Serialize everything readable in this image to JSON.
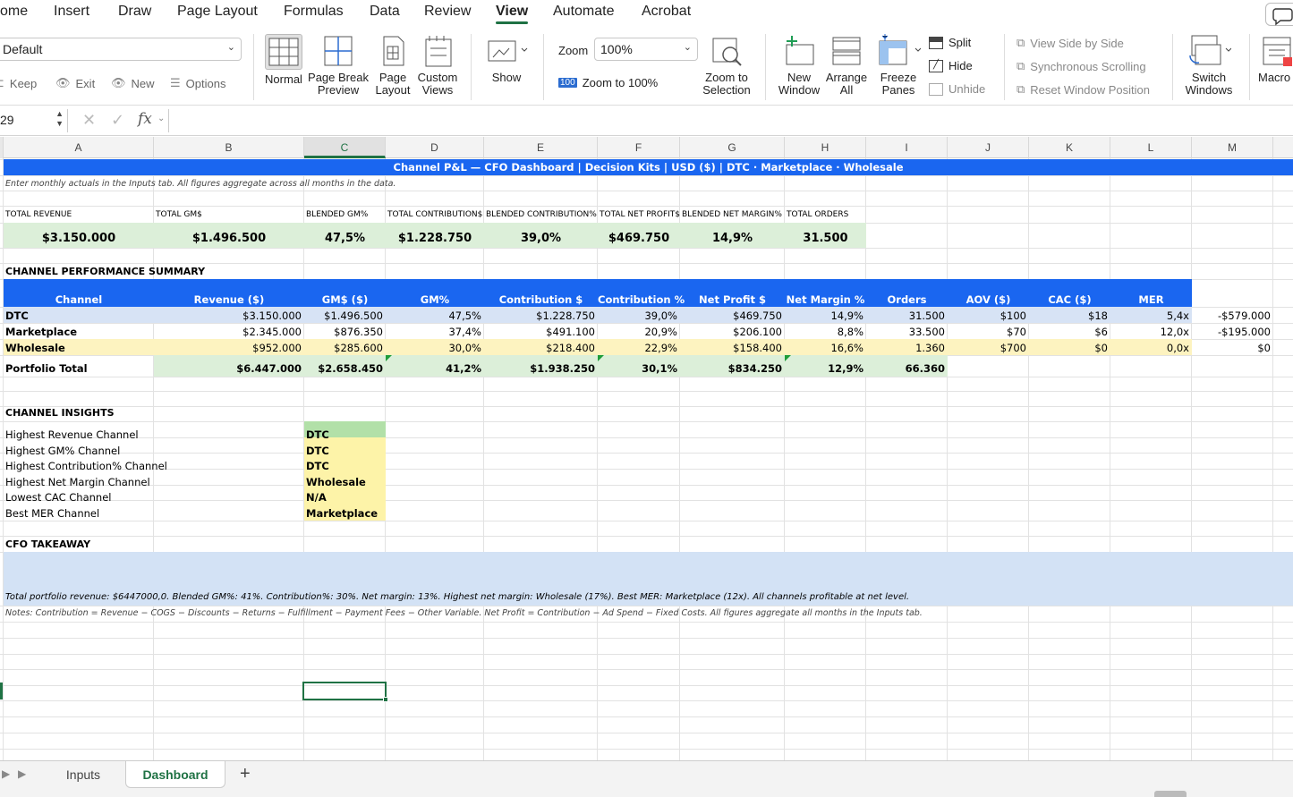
{
  "menu": {
    "tabs": [
      "ome",
      "Insert",
      "Draw",
      "Page Layout",
      "Formulas",
      "Data",
      "Review",
      "View",
      "Automate",
      "Acrobat"
    ],
    "active": "View"
  },
  "ribbon": {
    "sheet_view_combo": "Default",
    "keep": "Keep",
    "exit": "Exit",
    "new": "New",
    "options": "Options",
    "normal": "Normal",
    "page_break_preview": [
      "Page Break",
      "Preview"
    ],
    "page_layout": [
      "Page",
      "Layout"
    ],
    "custom_views": [
      "Custom",
      "Views"
    ],
    "show": "Show",
    "zoom_label": "Zoom",
    "zoom_value": "100%",
    "zoom_100_icon_text": "100",
    "zoom_to_100": "Zoom to 100%",
    "zoom_to_selection": [
      "Zoom to",
      "Selection"
    ],
    "new_window": [
      "New",
      "Window"
    ],
    "arrange_all": [
      "Arrange",
      "All"
    ],
    "freeze_panes": [
      "Freeze",
      "Panes"
    ],
    "split": "Split",
    "hide": "Hide",
    "unhide": "Unhide",
    "view_side_by_side": "View Side by Side",
    "synchronous_scrolling": "Synchronous Scrolling",
    "reset_window_position": "Reset Window Position",
    "switch_windows": [
      "Switch",
      "Windows"
    ],
    "macros": "Macro"
  },
  "formula_bar": {
    "name_box": "29",
    "fx": "fx",
    "formula": ""
  },
  "columns": [
    "A",
    "B",
    "C",
    "D",
    "E",
    "F",
    "G",
    "H",
    "I",
    "J",
    "K",
    "L",
    "M"
  ],
  "selected_column": "C",
  "sheet": {
    "title": "Channel P&L — CFO Dashboard  |  Decision Kits  |  USD ($)  |  DTC · Marketplace · Wholesale",
    "subtitle": "Enter monthly actuals in the Inputs tab. All figures aggregate across all months in the data.",
    "kpi_labels": [
      "TOTAL REVENUE",
      "TOTAL GM$",
      "BLENDED GM%",
      "TOTAL CONTRIBUTION$",
      "BLENDED CONTRIBUTION%",
      "TOTAL NET PROFIT$",
      "BLENDED NET MARGIN%",
      "TOTAL ORDERS"
    ],
    "kpi_values": [
      "$3.150.000",
      "$1.496.500",
      "47,5%",
      "$1.228.750",
      "39,0%",
      "$469.750",
      "14,9%",
      "31.500"
    ],
    "perf_header": "CHANNEL PERFORMANCE SUMMARY",
    "table_headers": [
      "Channel",
      "Revenue ($)",
      "GM$ ($)",
      "GM%",
      "Contribution $",
      "Contribution %",
      "Net Profit $",
      "Net Margin %",
      "Orders",
      "AOV ($)",
      "CAC ($)",
      "MER"
    ],
    "rows": [
      {
        "channel": "DTC",
        "values": [
          "$3.150.000",
          "$1.496.500",
          "47,5%",
          "$1.228.750",
          "39,0%",
          "$469.750",
          "14,9%",
          "31.500",
          "$100",
          "$18",
          "5,4x",
          "-$579.000"
        ]
      },
      {
        "channel": "Marketplace",
        "values": [
          "$2.345.000",
          "$876.350",
          "37,4%",
          "$491.100",
          "20,9%",
          "$206.100",
          "8,8%",
          "33.500",
          "$70",
          "$6",
          "12,0x",
          "-$195.000"
        ]
      },
      {
        "channel": "Wholesale",
        "values": [
          "$952.000",
          "$285.600",
          "30,0%",
          "$218.400",
          "22,9%",
          "$158.400",
          "16,6%",
          "1.360",
          "$700",
          "$0",
          "0,0x",
          "$0"
        ]
      }
    ],
    "total_row": {
      "label": "Portfolio Total",
      "values": [
        "$6.447.000",
        "$2.658.450",
        "41,2%",
        "$1.938.250",
        "30,1%",
        "$834.250",
        "12,9%",
        "66.360"
      ]
    },
    "insights_header": "CHANNEL INSIGHTS",
    "insights": [
      {
        "label": "Highest Revenue Channel",
        "value": "DTC"
      },
      {
        "label": "Highest GM% Channel",
        "value": "DTC"
      },
      {
        "label": "Highest Contribution% Channel",
        "value": "DTC"
      },
      {
        "label": "Highest Net Margin Channel",
        "value": "Wholesale"
      },
      {
        "label": "Lowest CAC Channel",
        "value": "N/A"
      },
      {
        "label": "Best MER Channel",
        "value": "Marketplace"
      }
    ],
    "takeaway_header": "CFO TAKEAWAY",
    "takeaway": "Total portfolio revenue: $6447000,0. Blended GM%: 41%. Contribution%: 30%. Net margin: 13%. Highest net margin: Wholesale (17%). Best MER: Marketplace (12x). All channels profitable at net level.",
    "notes": "Notes: Contribution = Revenue − COGS − Discounts − Returns − Fulfillment − Payment Fees − Other Variable. Net Profit = Contribution − Ad Spend − Fixed Costs. All figures aggregate all months in the Inputs tab."
  },
  "sheet_tabs": [
    "Inputs",
    "Dashboard"
  ],
  "active_sheet": "Dashboard",
  "colors": {
    "header_blue": "#1a66f0",
    "kpi_green": "#dcefd9",
    "dtc_row": "#d7e3f5",
    "wholesale_row": "#fdf3c0",
    "accent": "#1f7244",
    "takeaway_bg": "#d3e2f5"
  }
}
